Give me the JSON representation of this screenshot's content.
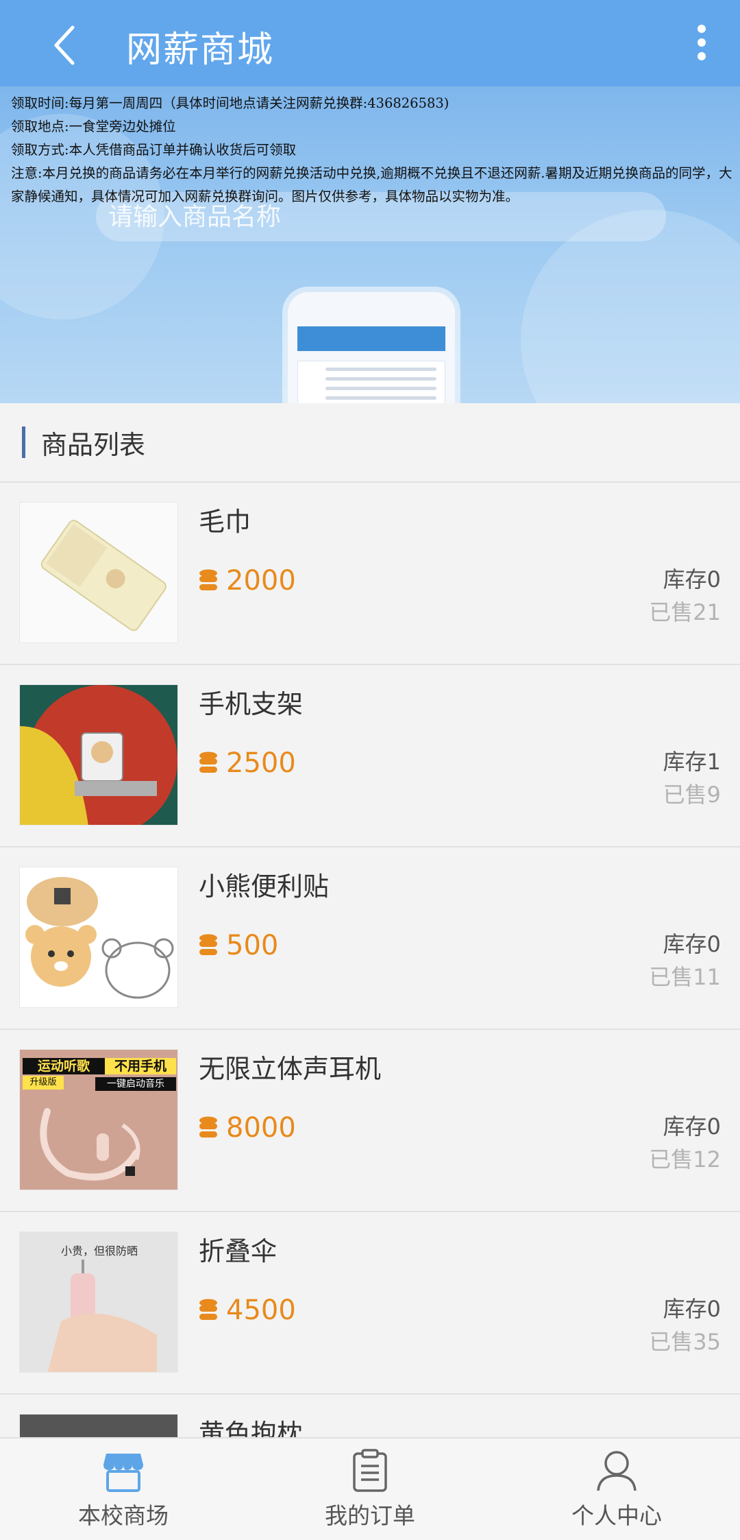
{
  "header": {
    "title": "网薪商城",
    "back_icon": "chevron-left-icon",
    "more_icon": "vertical-dots-icon"
  },
  "banner": {
    "search_placeholder": "请输入商品名称",
    "notice": {
      "line1": "领取时间:每月第一周周四（具体时间地点请关注网薪兑换群:436826583)",
      "line2": "领取地点:一食堂旁边处摊位",
      "line3": "领取方式:本人凭借商品订单并确认收货后可领取",
      "line4": "注意:本月兑换的商品请务必在本月举行的网薪兑换活动中兑换,逾期概不兑换且不退还网薪.暑期及近期兑换商品的同学，大家静候通知，具体情况可加入网薪兑换群询问。图片仅供参考，具体物品以实物为准。"
    }
  },
  "section": {
    "title": "商品列表"
  },
  "products": [
    {
      "name": "毛巾",
      "price": "2000",
      "stock": "库存0",
      "sold": "已售21"
    },
    {
      "name": "手机支架",
      "price": "2500",
      "stock": "库存1",
      "sold": "已售9"
    },
    {
      "name": "小熊便利贴",
      "price": "500",
      "stock": "库存0",
      "sold": "已售11"
    },
    {
      "name": "无限立体声耳机",
      "price": "8000",
      "stock": "库存0",
      "sold": "已售12",
      "thumb_text": {
        "a": "运动听歌",
        "b": "不用手机",
        "c": "升级版",
        "d": "一键启动音乐"
      }
    },
    {
      "name": "折叠伞",
      "price": "4500",
      "stock": "库存0",
      "sold": "已售35",
      "thumb_text": {
        "a": "小贵，但很防晒"
      }
    },
    {
      "name": "黄色抱枕"
    }
  ],
  "tabbar": {
    "items": [
      {
        "label": "本校商场",
        "icon": "store-icon",
        "active": true
      },
      {
        "label": "我的订单",
        "icon": "clipboard-icon",
        "active": false
      },
      {
        "label": "个人中心",
        "icon": "person-icon",
        "active": false
      }
    ]
  },
  "colors": {
    "header": "#62a7ec",
    "price": "#e88a1c",
    "accent_bar": "#4a6fa5",
    "active_tab": "#5ea5e8"
  }
}
